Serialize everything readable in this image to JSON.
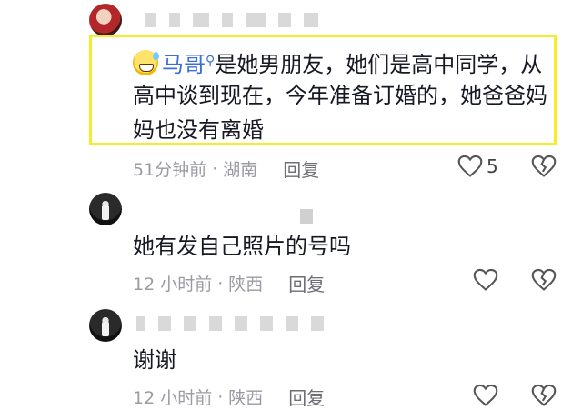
{
  "comments": [
    {
      "mention": "马哥",
      "text_line1": "是她男朋友，她们是高中同学，从",
      "text_line2": "高中谈到现在，今年准备订婚的，她爸爸妈",
      "text_line3": "妈也没有离婚",
      "time": "51分钟前",
      "location": "湖南",
      "reply": "回复",
      "likes": "5"
    },
    {
      "text": "她有发自己照片的号吗",
      "time": "12 小时前",
      "location": "陕西",
      "reply": "回复"
    },
    {
      "text": "谢谢",
      "time": "12 小时前",
      "location": "陕西",
      "reply": "回复"
    }
  ],
  "separator": "·",
  "icons": {
    "like": "heart-outline-icon",
    "dislike": "broken-heart-icon",
    "mention_search": "search-icon"
  },
  "colors": {
    "highlight": "#f5ec2b",
    "mention": "#3b6fd8",
    "meta": "#9b9ba3"
  }
}
